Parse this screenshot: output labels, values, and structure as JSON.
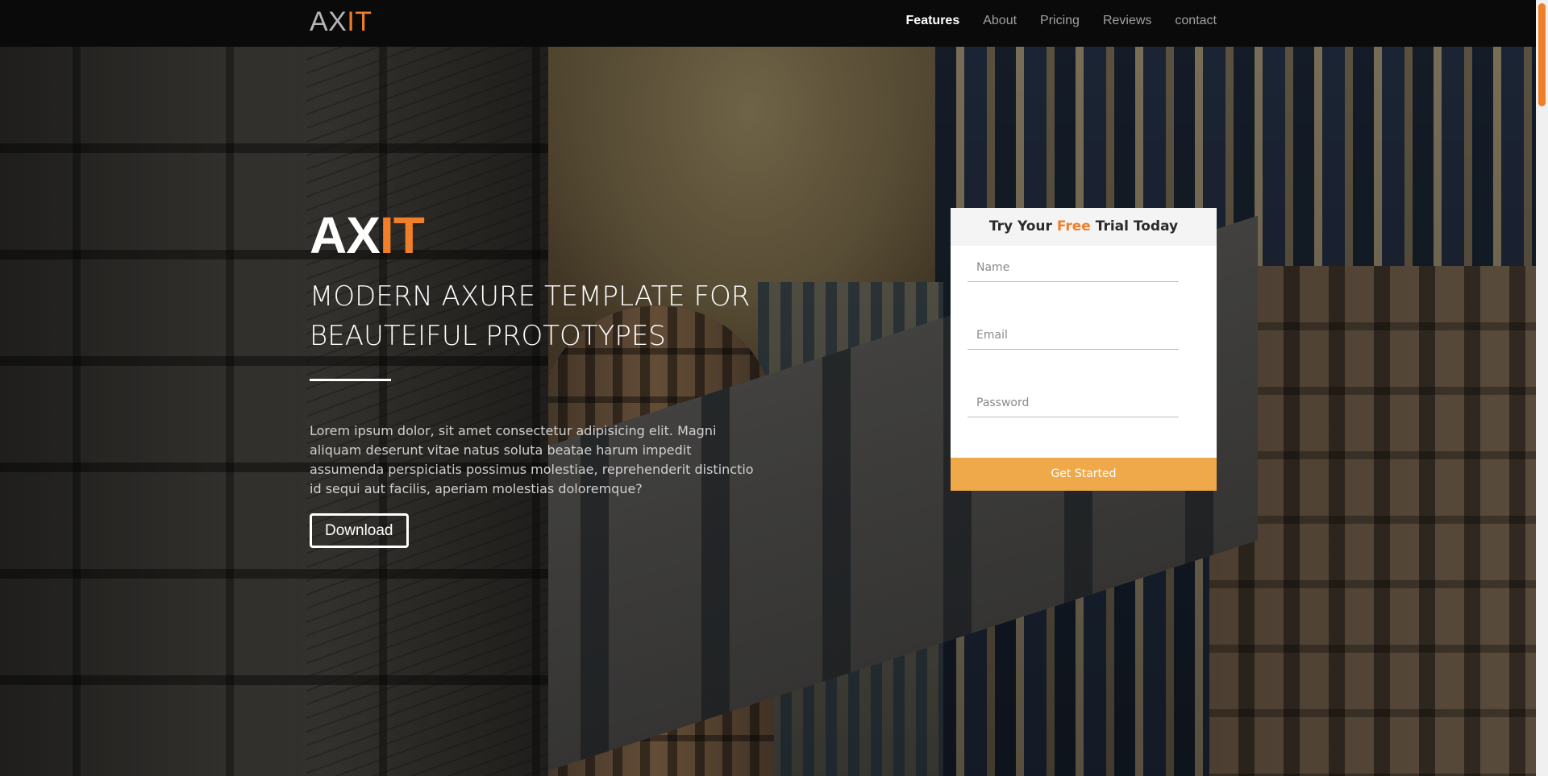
{
  "nav": {
    "logo_ax": "AX",
    "logo_it": "IT",
    "links": [
      {
        "label": "Features",
        "active": true
      },
      {
        "label": "About",
        "active": false
      },
      {
        "label": "Pricing",
        "active": false
      },
      {
        "label": "Reviews",
        "active": false
      },
      {
        "label": "contact",
        "active": false
      }
    ]
  },
  "hero": {
    "logo_ax": "AX",
    "logo_it": "IT",
    "headline_line1": "MODERN AXURE TEMPLATE FOR",
    "headline_line2": "BEAUTEIFUL PROTOTYPES",
    "body": "Lorem ipsum dolor, sit amet consectetur adipisicing elit. Magni aliquam deserunt vitae natus soluta beatae harum impedit assumenda perspiciatis possimus molestiae, reprehenderit distinctio id sequi aut facilis, aperiam molestias doloremque?",
    "download_label": "Download"
  },
  "trial_form": {
    "title_prefix": "Try Your ",
    "title_highlight": "Free",
    "title_suffix": " Trial Today",
    "name_placeholder": "Name",
    "email_placeholder": "Email",
    "password_placeholder": "Password",
    "submit_label": "Get Started"
  },
  "colors": {
    "accent_orange": "#f07f2a",
    "button_orange": "#efa94b",
    "nav_bg": "#0a0a0a"
  }
}
